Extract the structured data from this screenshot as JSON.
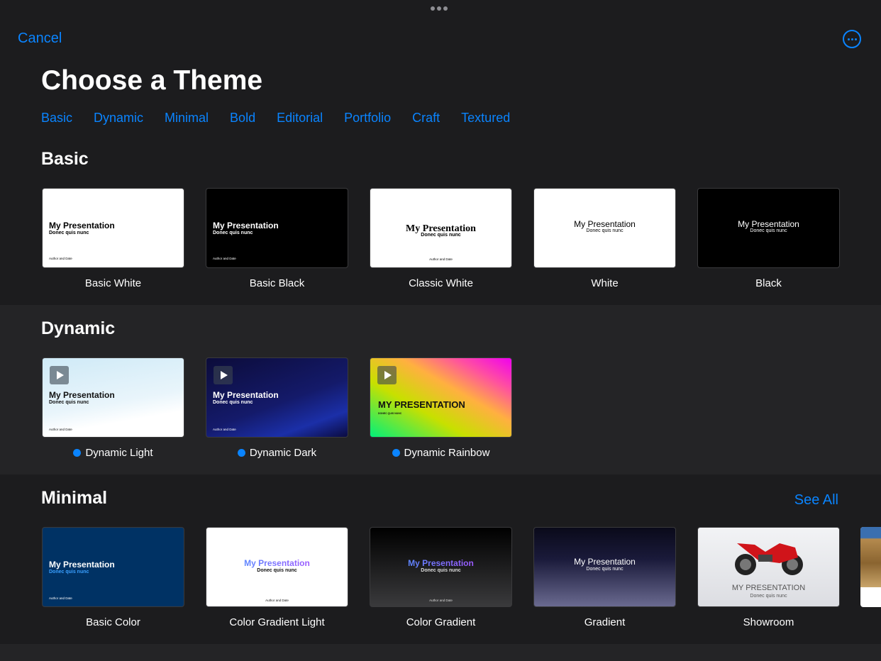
{
  "header": {
    "cancel_label": "Cancel",
    "title": "Choose a Theme",
    "more_icon": "ellipsis-circle-icon"
  },
  "tabs": [
    "Basic",
    "Dynamic",
    "Minimal",
    "Bold",
    "Editorial",
    "Portfolio",
    "Craft",
    "Textured"
  ],
  "preview_text": {
    "title": "My Presentation",
    "title_caps": "MY PRESENTATION",
    "subtitle": "Donec quis nunc",
    "subtitle_caps": "DONEC QUIS NUNC",
    "author": "Author and Date"
  },
  "sections": [
    {
      "title": "Basic",
      "themes": [
        {
          "name": "Basic White"
        },
        {
          "name": "Basic Black"
        },
        {
          "name": "Classic White"
        },
        {
          "name": "White"
        },
        {
          "name": "Black"
        }
      ]
    },
    {
      "title": "Dynamic",
      "themes": [
        {
          "name": "Dynamic Light",
          "dynamic": true
        },
        {
          "name": "Dynamic Dark",
          "dynamic": true
        },
        {
          "name": "Dynamic Rainbow",
          "dynamic": true
        }
      ]
    },
    {
      "title": "Minimal",
      "see_all": "See All",
      "themes": [
        {
          "name": "Basic Color"
        },
        {
          "name": "Color Gradient Light"
        },
        {
          "name": "Color Gradient"
        },
        {
          "name": "Gradient"
        },
        {
          "name": "Showroom"
        }
      ]
    }
  ],
  "colors": {
    "accent": "#0a84ff",
    "background": "#1c1c1e"
  }
}
